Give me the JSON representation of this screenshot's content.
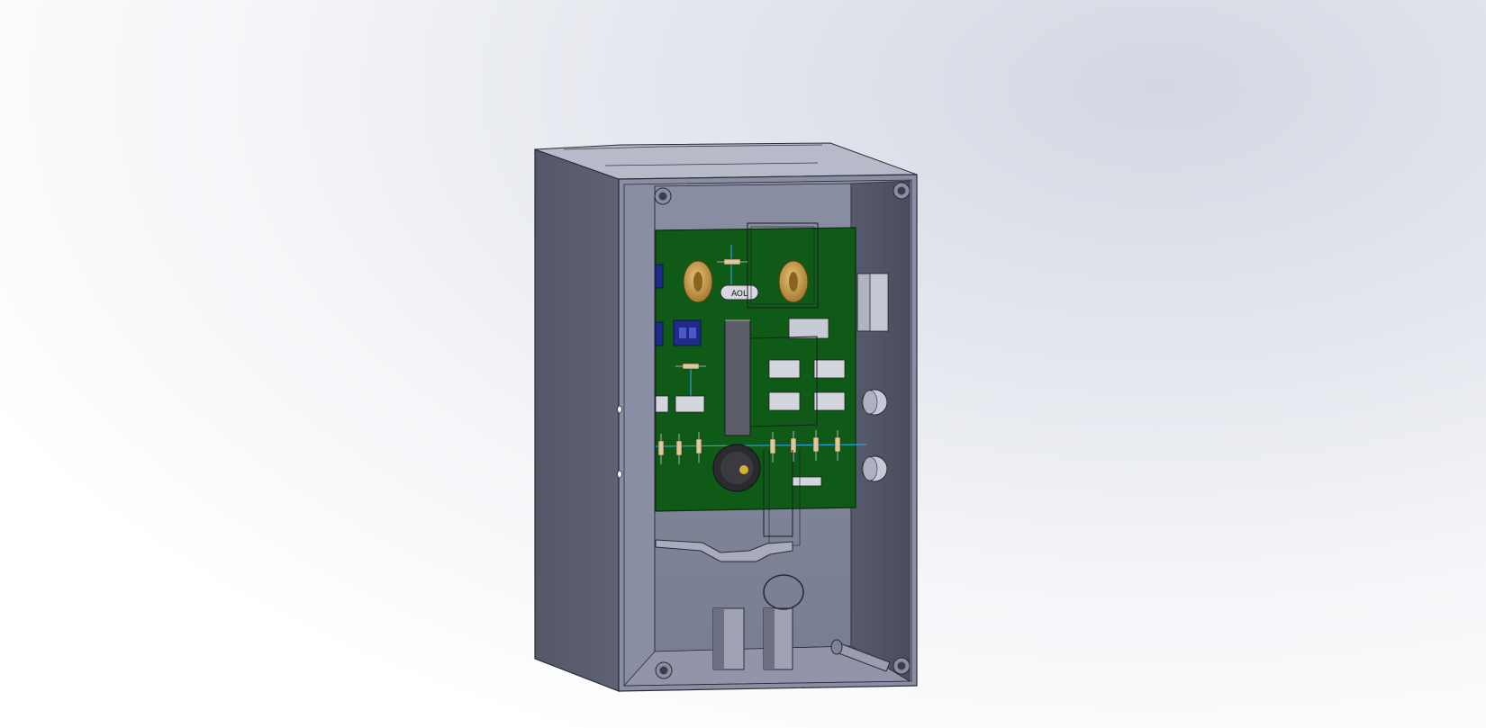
{
  "viewport": {
    "background_light": "#ffffff",
    "background_tint": "#d3d8e3"
  },
  "model": {
    "enclosure_color": "#7d8196",
    "enclosure_shadow": "#555868",
    "pcb_color": "#0f5a16",
    "pcb_label": "AOL"
  }
}
